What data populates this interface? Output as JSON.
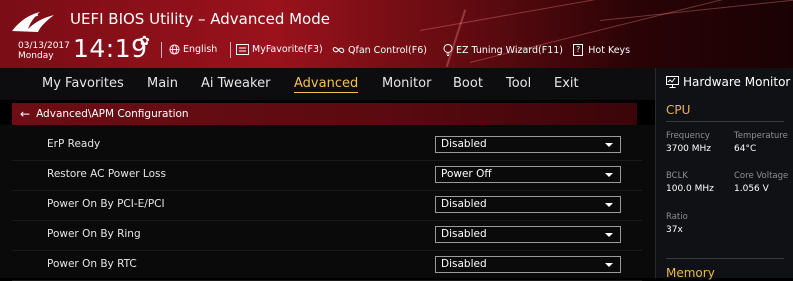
{
  "header": {
    "title": "UEFI BIOS Utility – Advanced Mode",
    "date": "03/13/2017",
    "day": "Monday",
    "time": "14:19",
    "items": [
      {
        "label": "English",
        "icon": "globe-icon"
      },
      {
        "label": "MyFavorite(F3)",
        "icon": "favorite-list-icon"
      },
      {
        "label": "Qfan Control(F6)",
        "icon": "fan-icon"
      },
      {
        "label": "EZ Tuning Wizard(F11)",
        "icon": "bulb-icon"
      },
      {
        "label": "Hot Keys",
        "key": "?",
        "icon": "hotkey-icon"
      }
    ]
  },
  "tabs": [
    {
      "label": "My Favorites"
    },
    {
      "label": "Main"
    },
    {
      "label": "Ai Tweaker"
    },
    {
      "label": "Advanced",
      "active": true
    },
    {
      "label": "Monitor"
    },
    {
      "label": "Boot"
    },
    {
      "label": "Tool"
    },
    {
      "label": "Exit"
    }
  ],
  "breadcrumb": "Advanced\\APM Configuration",
  "settings": [
    {
      "label": "ErP Ready",
      "value": "Disabled"
    },
    {
      "label": "Restore AC Power Loss",
      "value": "Power Off"
    },
    {
      "label": "Power On By PCI-E/PCI",
      "value": "Disabled"
    },
    {
      "label": "Power On By Ring",
      "value": "Disabled"
    },
    {
      "label": "Power On By RTC",
      "value": "Disabled"
    }
  ],
  "hardware_monitor": {
    "title": "Hardware Monitor",
    "cpu": {
      "section": "CPU",
      "frequency_label": "Frequency",
      "frequency": "3700 MHz",
      "temperature_label": "Temperature",
      "temperature": "64°C",
      "bclk_label": "BCLK",
      "bclk": "100.0 MHz",
      "core_voltage_label": "Core Voltage",
      "core_voltage": "1.056 V",
      "ratio_label": "Ratio",
      "ratio": "37x"
    },
    "memory_section": "Memory"
  },
  "colors": {
    "header_red": "#9a121c",
    "active_tab": "#f2c250",
    "section_gold": "#e8b84a",
    "breadcrumb_red": "#6e0d14"
  }
}
